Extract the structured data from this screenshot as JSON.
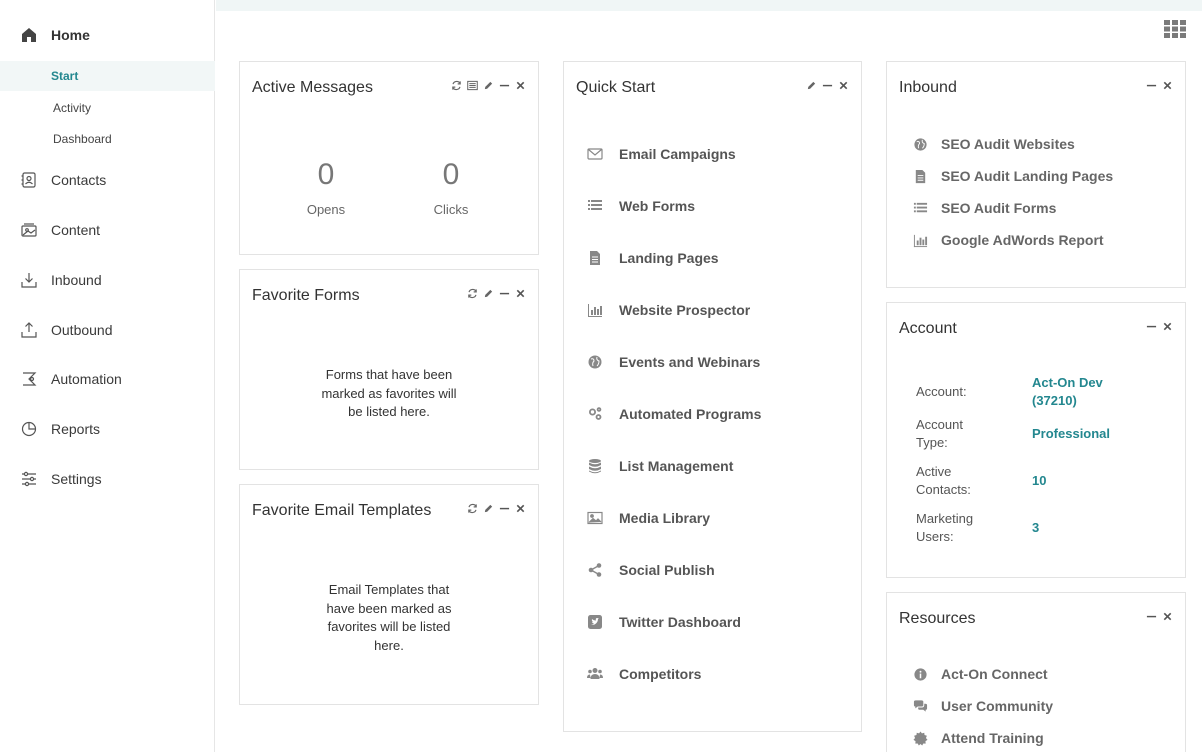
{
  "sidebar": {
    "home": "Home",
    "sub": [
      "Start",
      "Activity",
      "Dashboard"
    ],
    "items": [
      "Contacts",
      "Content",
      "Inbound",
      "Outbound",
      "Automation",
      "Reports",
      "Settings"
    ]
  },
  "active_messages": {
    "title": "Active Messages",
    "opens_value": "0",
    "opens_label": "Opens",
    "clicks_value": "0",
    "clicks_label": "Clicks"
  },
  "favorite_forms": {
    "title": "Favorite Forms",
    "line1": "Forms that have been",
    "line2": "marked as favorites will",
    "line3": "be listed here."
  },
  "favorite_email_templates": {
    "title": "Favorite Email Templates",
    "line1": "Email Templates that",
    "line2": "have been marked as",
    "line3": "favorites will be listed",
    "line4": "here."
  },
  "quick_start": {
    "title": "Quick Start",
    "items": [
      "Email Campaigns",
      "Web Forms",
      "Landing Pages",
      "Website Prospector",
      "Events and Webinars",
      "Automated Programs",
      "List Management",
      "Media Library",
      "Social Publish",
      "Twitter Dashboard",
      "Competitors"
    ]
  },
  "inbound": {
    "title": "Inbound",
    "items": [
      "SEO Audit Websites",
      "SEO Audit Landing Pages",
      "SEO Audit Forms",
      "Google AdWords Report"
    ]
  },
  "account": {
    "title": "Account",
    "account_label": "Account:",
    "account_value_1": "Act-On Dev",
    "account_value_2": "(37210)",
    "type_label_1": "Account",
    "type_label_2": "Type:",
    "type_value": "Professional",
    "contacts_label_1": "Active",
    "contacts_label_2": "Contacts:",
    "contacts_value": "10",
    "users_label_1": "Marketing",
    "users_label_2": "Users:",
    "users_value": "3"
  },
  "resources": {
    "title": "Resources",
    "items": [
      "Act-On Connect",
      "User Community",
      "Attend Training"
    ]
  },
  "colors": {
    "accent": "#23878f",
    "icon_gray": "#8a8a8a"
  }
}
